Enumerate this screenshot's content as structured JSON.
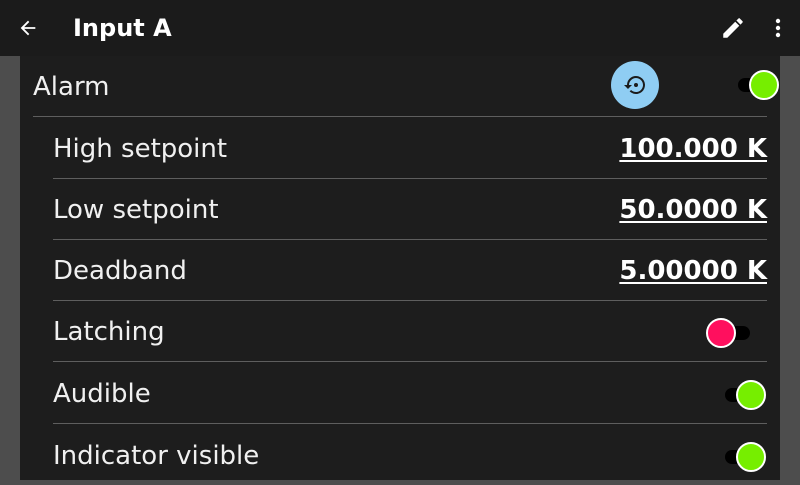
{
  "appbar": {
    "title": "Input A",
    "back_icon": "arrow-left-icon",
    "edit_icon": "pencil-icon",
    "more_icon": "more-vert-icon"
  },
  "alarm": {
    "label": "Alarm",
    "reset_icon": "restore-history-icon",
    "enabled": true
  },
  "settings": [
    {
      "label": "High setpoint",
      "value": "100.000 K"
    },
    {
      "label": "Low setpoint",
      "value": "50.0000 K"
    },
    {
      "label": "Deadband",
      "value": "5.00000 K"
    },
    {
      "label": "Latching",
      "toggle": false
    },
    {
      "label": "Audible",
      "toggle": true
    },
    {
      "label": "Indicator visible",
      "toggle": true
    }
  ],
  "colors": {
    "toggle_on": "#76ee00",
    "toggle_off": "#ff0f5e",
    "reset_button": "#8fcdf3",
    "appbar": "#1b1b1b",
    "panel": "#1d1d1d"
  }
}
